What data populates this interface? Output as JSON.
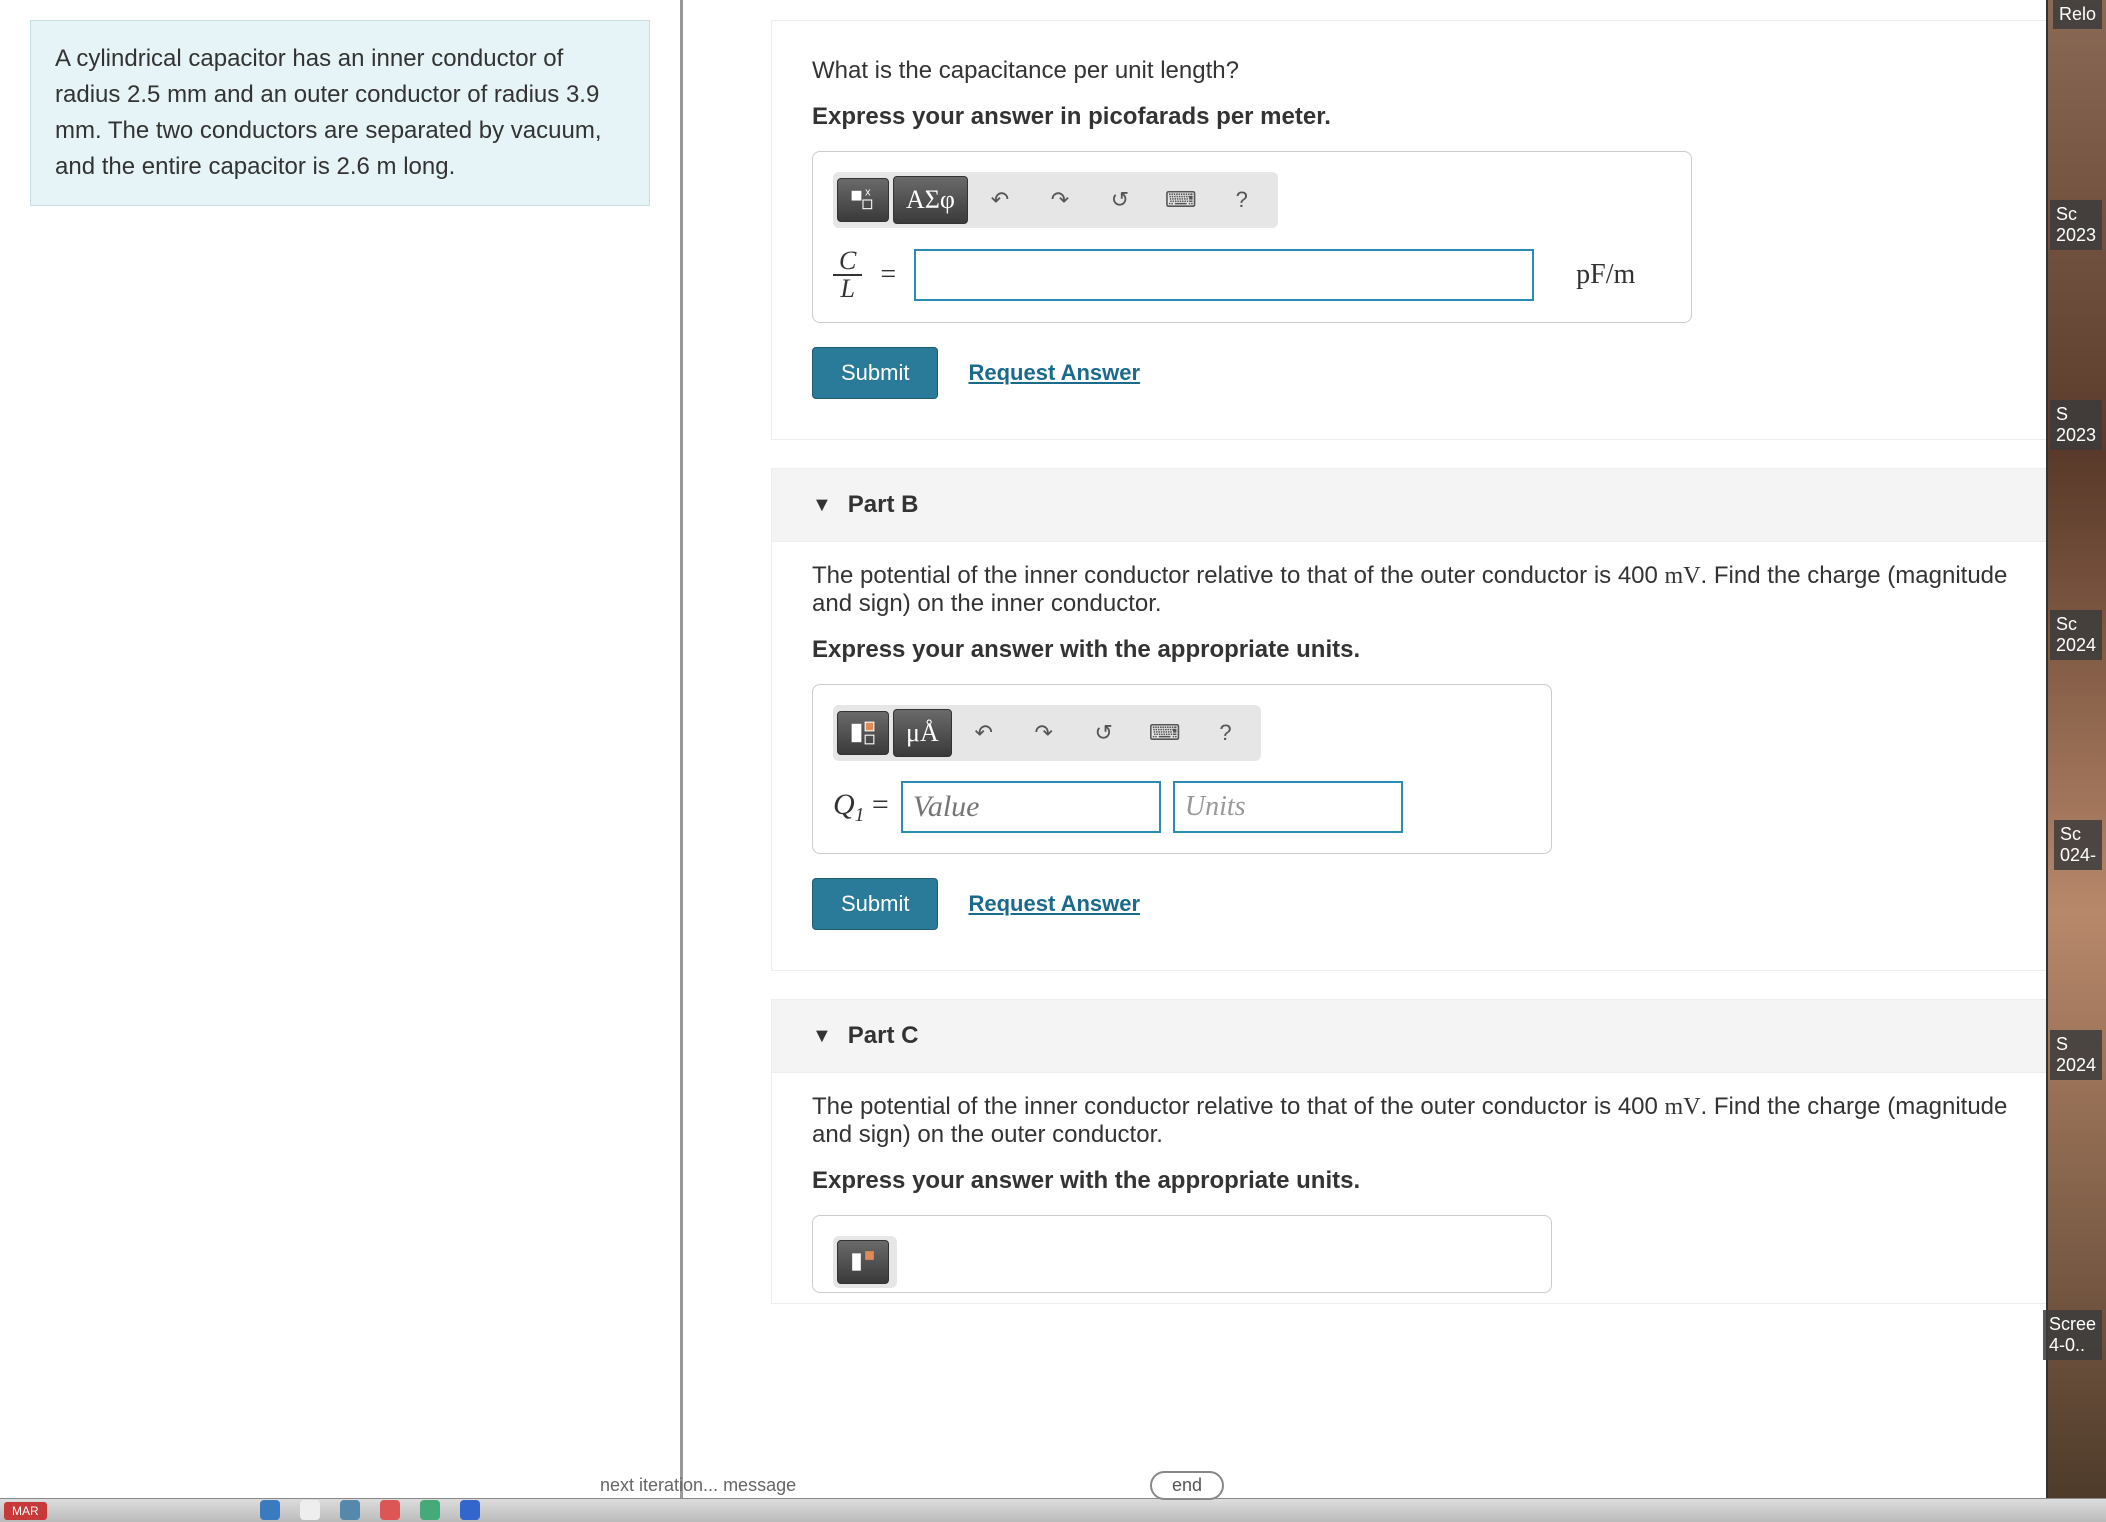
{
  "problem": {
    "text": "A cylindrical capacitor has an inner conductor of radius 2.5 mm and an outer conductor of radius 3.9 mm. The two conductors are separated by vacuum, and the entire capacitor is 2.6 m long."
  },
  "partA": {
    "question": "What is the capacitance per unit length?",
    "instruction": "Express your answer in picofarads per meter.",
    "prefix_num": "C",
    "prefix_den": "L",
    "equals": "=",
    "unit": "pF/m",
    "submit": "Submit",
    "request": "Request Answer",
    "toolbar": {
      "templates": "",
      "symbols": "ΑΣφ",
      "undo": "↶",
      "redo": "↷",
      "reset": "↺",
      "keyboard": "⌨",
      "help": "?"
    }
  },
  "partB": {
    "title": "Part B",
    "question_html": "The potential of the inner conductor relative to that of the outer conductor is 400 mV. Find the charge (magnitude and sign) on the inner conductor.",
    "instruction": "Express your answer with the appropriate units.",
    "prefix": "Q",
    "prefix_sub": "1",
    "equals": "=",
    "value_placeholder": "Value",
    "units_placeholder": "Units",
    "submit": "Submit",
    "request": "Request Answer",
    "toolbar": {
      "templates": "",
      "units_btn": "μÅ",
      "undo": "↶",
      "redo": "↷",
      "reset": "↺",
      "keyboard": "⌨",
      "help": "?"
    }
  },
  "partC": {
    "title": "Part C",
    "question_html": "The potential of the inner conductor relative to that of the outer conductor is 400 mV. Find the charge (magnitude and sign) on the outer conductor.",
    "instruction": "Express your answer with the appropriate units."
  },
  "footer": {
    "next": "next iteration... message",
    "end": "end",
    "mar": "MAR"
  },
  "side": {
    "l1": "Relo",
    "l2": "Sc",
    "l2b": "2023",
    "l3": "S",
    "l3b": "2023",
    "l4": "Sc",
    "l4b": "2024",
    "l5": "Sc",
    "l5b": "024-",
    "l6": "S",
    "l6b": "2024",
    "l7": "Scree",
    "l7b": "4-0.."
  }
}
